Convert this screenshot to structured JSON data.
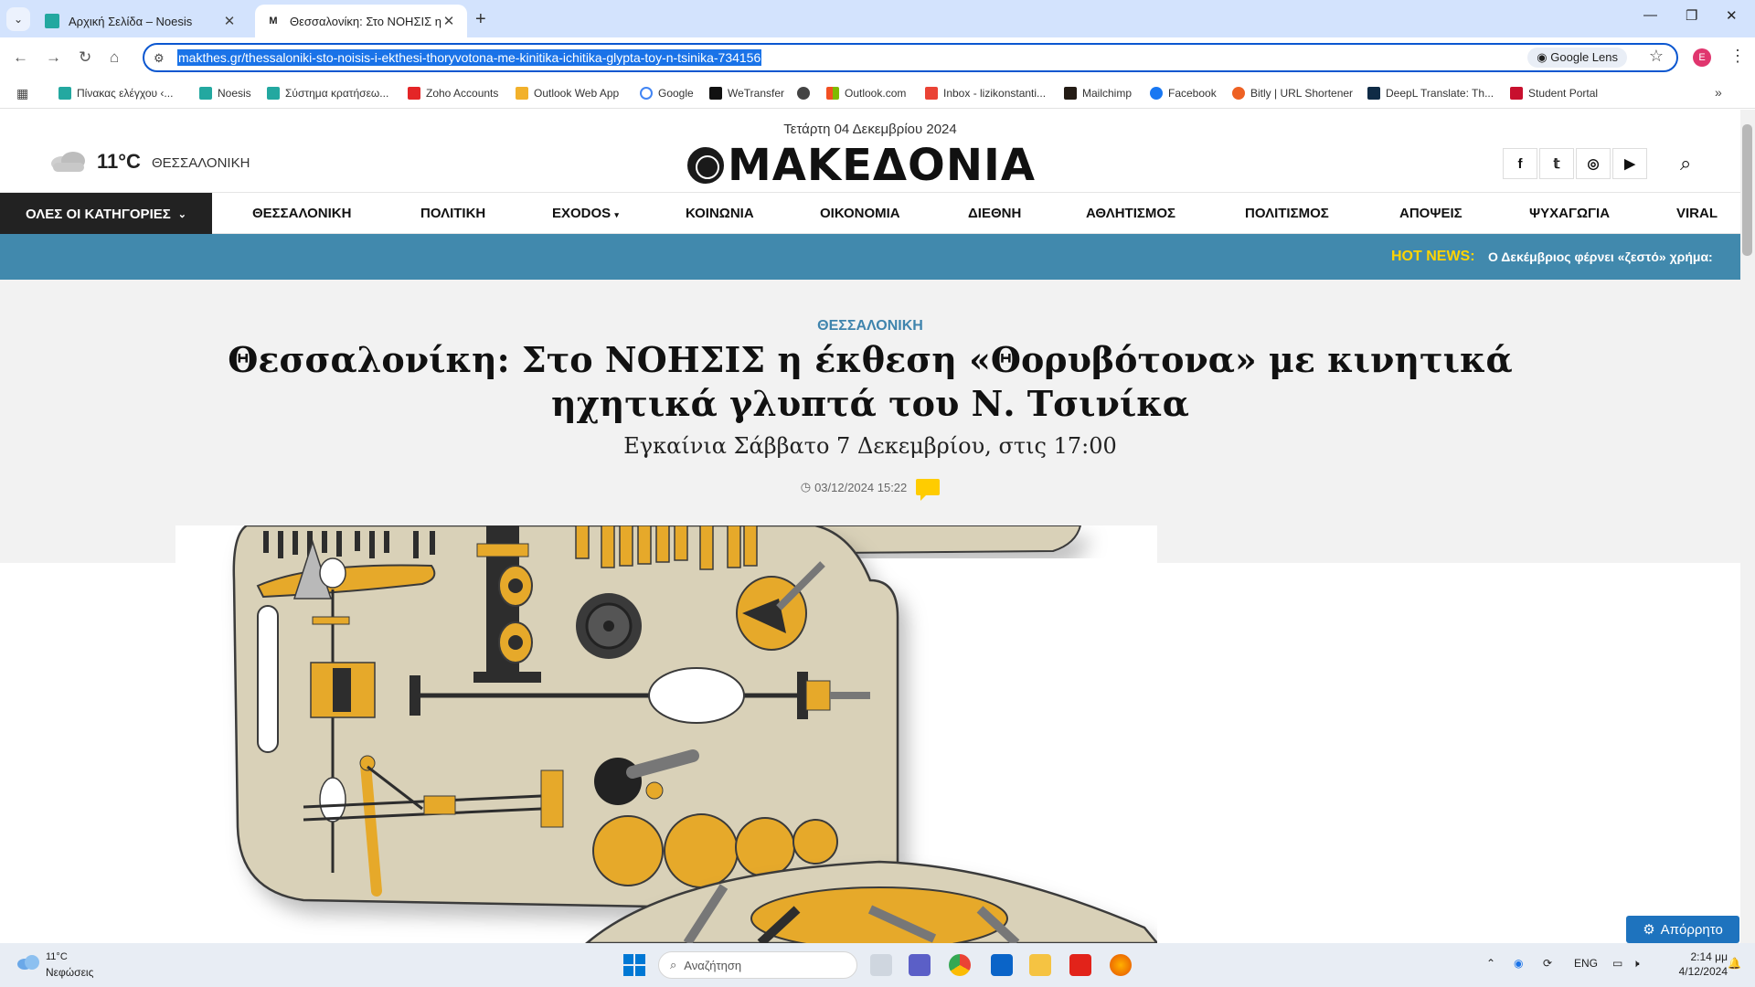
{
  "browser": {
    "tabs": [
      {
        "title": "Αρχική Σελίδα – Noesis",
        "active": false
      },
      {
        "title": "Θεσσαλονίκη: Στο ΝΟΗΣΙΣ η έκ",
        "active": true
      }
    ],
    "url": "makthes.gr/thessaloniki-sto-noisis-i-ekthesi-thoryvotona-me-kinitika-ichitika-glypta-toy-n-tsinika-734156",
    "lens_label": "Google Lens",
    "profile_initial": "E",
    "bookmarks": [
      "Πίνακας ελέγχου ‹...",
      "Noesis",
      "Σύστημα κρατήσεω...",
      "Zoho Accounts",
      "Outlook Web App",
      "Google",
      "WeTransfer",
      "",
      "Outlook.com",
      "Inbox - lizikonstanti...",
      "Mailchimp",
      "Facebook",
      "Bitly | URL Shortener",
      "DeepL Translate: Th...",
      "Student Portal"
    ]
  },
  "site": {
    "date": "Τετάρτη 04 Δεκεμβρίου 2024",
    "weather": {
      "temp": "11°C",
      "city": "ΘΕΣΣΑΛΟΝΙΚΗ"
    },
    "logo_text": "ΜΑΚΕΔΟΝΙΑ",
    "social": [
      "f",
      "t",
      "ig",
      "yt"
    ],
    "nav": {
      "all_categories": "ΟΛΕΣ ΟΙ ΚΑΤΗΓΟΡΙΕΣ",
      "items": [
        "ΘΕΣΣΑΛΟΝΙΚΗ",
        "ΠΟΛΙΤΙΚΗ",
        "EXODOS",
        "ΚΟΙΝΩΝΙΑ",
        "ΟΙΚΟΝΟΜΙΑ",
        "ΔΙΕΘΝΗ",
        "ΑΘΛΗΤΙΣΜΟΣ",
        "ΠΟΛΙΤΙΣΜΟΣ",
        "ΑΠΟΨΕΙΣ",
        "ΨΥΧΑΓΩΓΙΑ",
        "VIRAL"
      ]
    },
    "hot_news": {
      "label": "HOT NEWS:",
      "text": "Ο Δεκέμβριος φέρνει «ζεστό» χρήμα:"
    },
    "article": {
      "category": "ΘΕΣΣΑΛΟΝΙΚΗ",
      "title": "Θεσσαλονίκη: Στο ΝΟΗΣΙΣ η έκθεση «Θορυβότονα» με κινητικά ηχητικά γλυπτά του Ν. Τσινίκα",
      "subtitle": "Εγκαίνια Σάββατο 7 Δεκεμβρίου, στις 17:00",
      "datetime": "03/12/2024 15:22"
    },
    "privacy_button": "Απόρρητο"
  },
  "taskbar": {
    "weather_temp": "11°C",
    "weather_cond": "Νεφώσεις",
    "search_placeholder": "Αναζήτηση",
    "lang": "ENG",
    "time": "2:14 μμ",
    "date": "4/12/2024"
  },
  "colors": {
    "hot_bar": "#4189ad",
    "hot_label": "#ffd400",
    "category": "#3f84ad",
    "sculpture_base": "#d9d1b8",
    "sculpture_accent": "#e6a92a"
  }
}
